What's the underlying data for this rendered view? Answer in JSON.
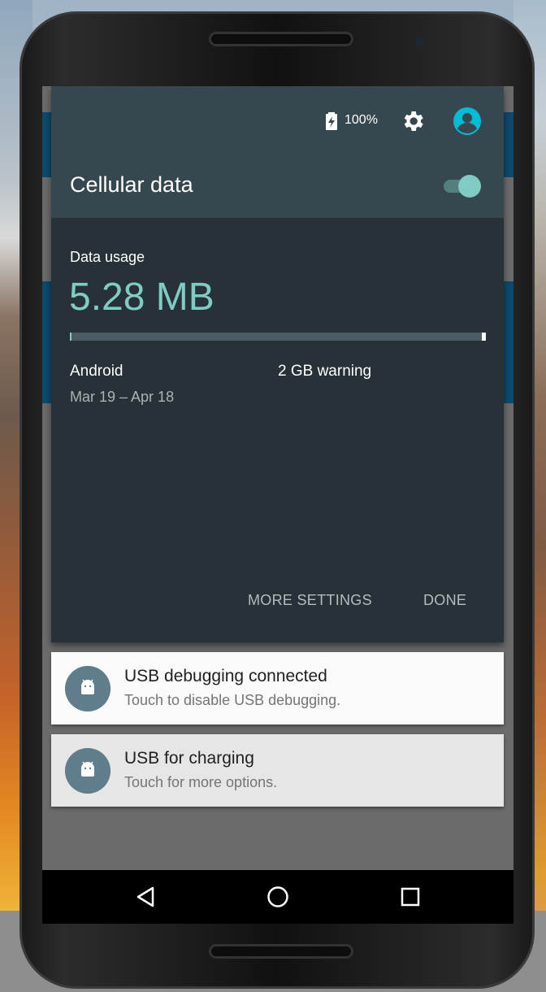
{
  "status": {
    "battery_percent": "100%"
  },
  "quick_settings": {
    "title": "Cellular data",
    "toggle_on": true,
    "usage_label": "Data usage",
    "usage_value": "5.28 MB",
    "carrier": "Android",
    "warning": "2 GB warning",
    "period": "Mar 19 – Apr 18",
    "usage_fraction": 0.003,
    "buttons": {
      "more_settings": "MORE SETTINGS",
      "done": "DONE"
    }
  },
  "notifications": [
    {
      "title": "USB debugging connected",
      "text": "Touch to disable USB debugging."
    },
    {
      "title": "USB for charging",
      "text": "Touch for more options."
    }
  ],
  "colors": {
    "accent": "#80cbc4",
    "panel": "#263238",
    "header": "#37474f",
    "notif_icon": "#607d8b"
  },
  "navbar": {
    "icons": [
      "back-icon",
      "home-icon",
      "recents-icon"
    ]
  }
}
